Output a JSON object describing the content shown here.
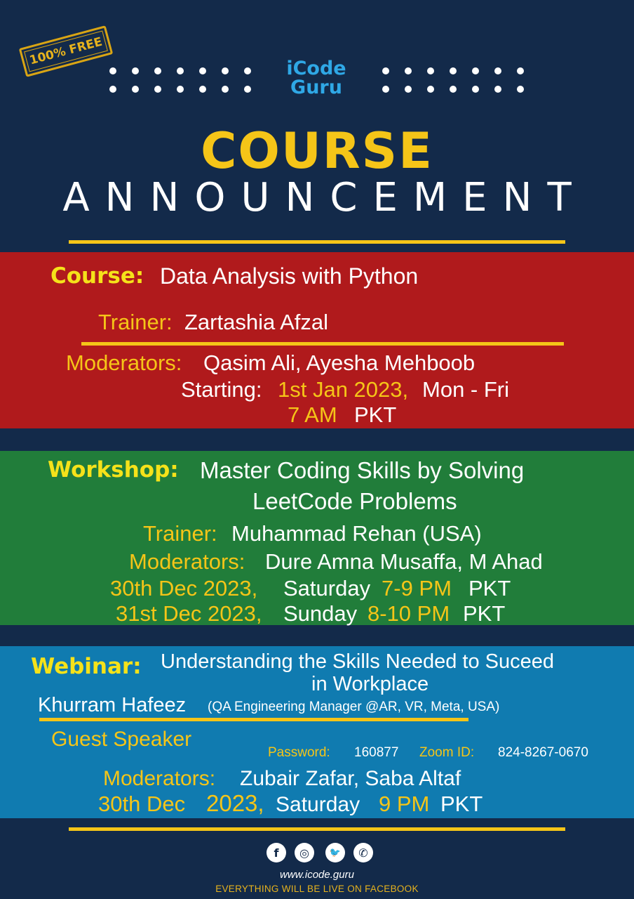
{
  "badge": "100% FREE",
  "logo": {
    "line1": "iCode",
    "line2": "Guru"
  },
  "heading": {
    "line1": "COURSE",
    "line2": "ANNOUNCEMENT"
  },
  "course": {
    "label": "Course:",
    "title": "Data Analysis with Python",
    "trainer_label": "Trainer:",
    "trainer": "Zartashia Afzal",
    "moderators_label": "Moderators:",
    "moderators": "Qasim Ali, Ayesha Mehboob",
    "starting_label": "Starting:",
    "start_date": "1st Jan 2023,",
    "days": "Mon - Fri",
    "time": "7 AM",
    "tz": "PKT"
  },
  "workshop": {
    "label": "Workshop:",
    "title_line1": "Master Coding Skills by Solving",
    "title_line2": "LeetCode Problems",
    "trainer_label": "Trainer:",
    "trainer": "Muhammad Rehan (USA)",
    "moderators_label": "Moderators:",
    "moderators": "Dure Amna Musaffa, M Ahad",
    "s1_date": "30th  Dec  2023,",
    "s1_day": "Saturday",
    "s1_time": "7-9  PM",
    "s1_tz": "PKT",
    "s2_date": "31st  Dec  2023,",
    "s2_day": "Sunday",
    "s2_time": "8-10 PM",
    "s2_tz": "PKT"
  },
  "webinar": {
    "label": "Webinar:",
    "title_line1": "Understanding the Skills Needed to Suceed",
    "title_line2": "in Workplace",
    "speaker": "Khurram Hafeez",
    "speaker_role": "(QA Engineering Manager @AR, VR, Meta, USA)",
    "guest": "Guest Speaker",
    "password_label": "Password:",
    "password": "160877",
    "zoom_label": "Zoom ID:",
    "zoom_id": "824-8267-0670",
    "moderators_label": "Moderators:",
    "moderators": "Zubair Zafar, Saba Altaf",
    "date_part1": "30th  Dec",
    "date_part2": "2023,",
    "day": "Saturday",
    "time": "9  PM",
    "tz": "PKT"
  },
  "social": [
    {
      "icon": "facebook-icon",
      "glyph": "f"
    },
    {
      "icon": "instagram-icon",
      "glyph": "◎"
    },
    {
      "icon": "twitter-icon",
      "glyph": "🐦"
    },
    {
      "icon": "whatsapp-icon",
      "glyph": "✆"
    }
  ],
  "website": "www.icode.guru",
  "footer": "EVERYTHING WILL BE LIVE ON FACEBOOK",
  "colors": {
    "navy": "#132a4a",
    "yellow": "#f5c518",
    "red": "#b01a1c",
    "green": "#217d3a",
    "blue": "#107bb0",
    "logo_blue": "#2fa8e6"
  }
}
